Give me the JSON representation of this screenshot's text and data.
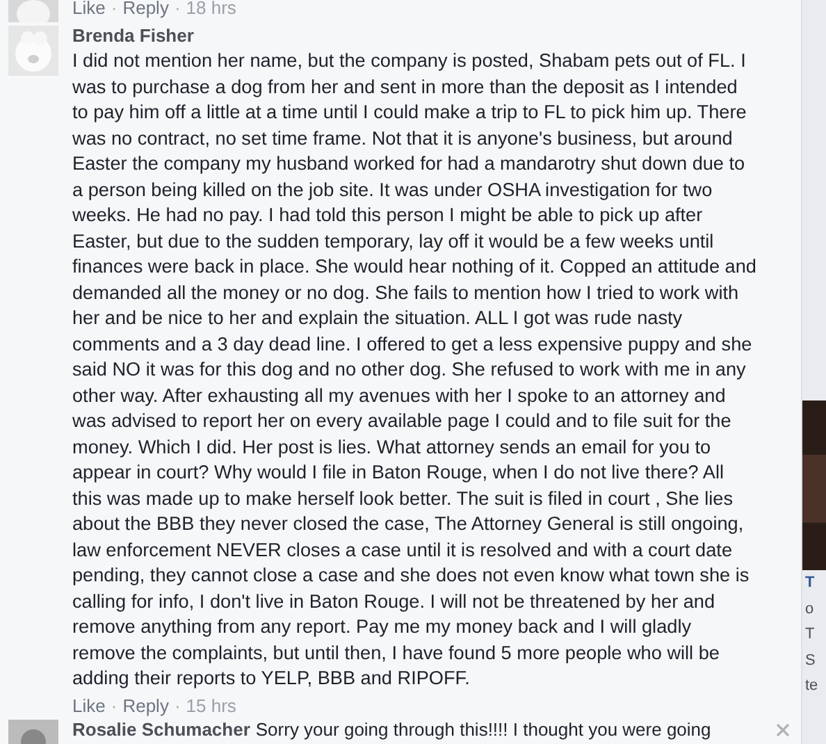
{
  "previous_comment": {
    "actions": [
      "Like",
      "Reply"
    ],
    "separator": "·",
    "time": "18 hrs"
  },
  "comment": {
    "author": "Brenda Fisher",
    "text": "I did not mention her name, but the company is posted, Shabam pets out of FL. I was to purchase a dog from her and sent in more than the deposit as I intended to pay him off a little at a time until I could make a trip to FL to pick him up. There was no contract, no set time frame. Not that it is anyone's business, but around Easter the company my husband worked for had a mandarotry shut down due to a person being killed on the job site. It was under OSHA investigation for two weeks. He had no pay. I had told this person I might be able to pick up after Easter, but due to the sudden temporary, lay off it would be a few weeks until finances were back in place. She would hear nothing of it. Copped an attitude and demanded all the money or no dog. She fails to mention how I tried to work with her and be nice to her and explain the situation. ALL I got was rude nasty comments and a 3 day dead line. I offered to get a less expensive puppy and she said NO it was for this dog and no other dog. She refused to work with me in any other way. After exhausting all my avenues with her I spoke to an attorney and was advised to report her on every available page I could and to file suit for the money. Which I did. Her post is lies. What attorney sends an email for you to appear in court? Why would I file in Baton Rouge, when I do not live there? All this was made up to make herself look better. The suit is filed in court , She lies about the BBB they never closed the case, The Attorney General is still ongoing, law enforcement NEVER closes a case until it is resolved and with a court date pending, they cannot close a case and she does not even know what town she is calling for info, I don't live in Baton Rouge. I will not be threatened by her and remove anything from any report. Pay me my money back and I will gladly remove the complaints, but until then, I have found 5 more people who will be adding their reports to YELP, BBB and RIPOFF.",
    "actions": [
      "Like",
      "Reply"
    ],
    "separator": "·",
    "time": "15 hrs"
  },
  "next_reply": {
    "author": "Rosalie Schumacher",
    "text": "Sorry your going through this!!!! I thought you were going"
  },
  "sidebar_fragments": [
    "T",
    "o",
    "T",
    "S",
    "te"
  ]
}
